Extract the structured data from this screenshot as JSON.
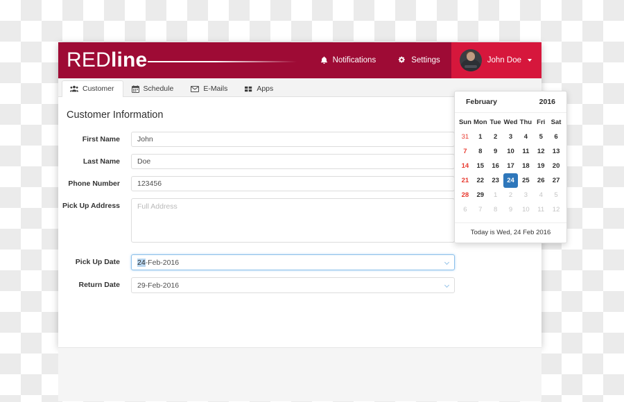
{
  "brand": {
    "red_part": "RED",
    "line_part": "line",
    "accent_color": "#9e0b35",
    "accent_color_light": "#d6173c"
  },
  "header": {
    "nav": [
      {
        "label": "Notifications",
        "icon": "bell-icon"
      },
      {
        "label": "Settings",
        "icon": "gear-icon"
      }
    ],
    "user": {
      "name": "John Doe",
      "avatar_icon": "avatar",
      "caret_icon": "caret-down-icon"
    }
  },
  "tabs": [
    {
      "label": "Customer",
      "icon": "users-icon",
      "active": true
    },
    {
      "label": "Schedule",
      "icon": "calendar-icon",
      "active": false
    },
    {
      "label": "E-Mails",
      "icon": "envelope-icon",
      "active": false
    },
    {
      "label": "Apps",
      "icon": "grid-icon",
      "active": false
    }
  ],
  "main": {
    "title": "Customer Information",
    "fields": {
      "first_name": {
        "label": "First Name",
        "value": "John",
        "placeholder": ""
      },
      "last_name": {
        "label": "Last Name",
        "value": "Doe",
        "placeholder": ""
      },
      "phone_number": {
        "label": "Phone Number",
        "value": "123456",
        "placeholder": ""
      },
      "pick_up_address": {
        "label": "Pick Up Address",
        "value": "",
        "placeholder": "Full Address"
      },
      "pick_up_date": {
        "label": "Pick Up Date",
        "value": "24-Feb-2016",
        "selected_text": "24",
        "rest_text": "-Feb-2016",
        "focused": true
      },
      "return_date": {
        "label": "Return Date",
        "value": "29-Feb-2016",
        "focused": false
      }
    }
  },
  "datepicker": {
    "month": "February",
    "year": "2016",
    "weekdays": [
      "Sun",
      "Mon",
      "Tue",
      "Wed",
      "Thu",
      "Fri",
      "Sat"
    ],
    "selected_day": 24,
    "footer": "Today is Wed, 24 Feb 2016",
    "weeks": [
      [
        {
          "d": "31",
          "muted": true,
          "sunday": true,
          "selected": false
        },
        {
          "d": "1",
          "muted": false,
          "sunday": false,
          "selected": false
        },
        {
          "d": "2",
          "muted": false,
          "sunday": false,
          "selected": false
        },
        {
          "d": "3",
          "muted": false,
          "sunday": false,
          "selected": false
        },
        {
          "d": "4",
          "muted": false,
          "sunday": false,
          "selected": false
        },
        {
          "d": "5",
          "muted": false,
          "sunday": false,
          "selected": false
        },
        {
          "d": "6",
          "muted": false,
          "sunday": false,
          "selected": false
        }
      ],
      [
        {
          "d": "7",
          "muted": false,
          "sunday": true,
          "selected": false
        },
        {
          "d": "8",
          "muted": false,
          "sunday": false,
          "selected": false
        },
        {
          "d": "9",
          "muted": false,
          "sunday": false,
          "selected": false
        },
        {
          "d": "10",
          "muted": false,
          "sunday": false,
          "selected": false
        },
        {
          "d": "11",
          "muted": false,
          "sunday": false,
          "selected": false
        },
        {
          "d": "12",
          "muted": false,
          "sunday": false,
          "selected": false
        },
        {
          "d": "13",
          "muted": false,
          "sunday": false,
          "selected": false
        }
      ],
      [
        {
          "d": "14",
          "muted": false,
          "sunday": true,
          "selected": false
        },
        {
          "d": "15",
          "muted": false,
          "sunday": false,
          "selected": false
        },
        {
          "d": "16",
          "muted": false,
          "sunday": false,
          "selected": false
        },
        {
          "d": "17",
          "muted": false,
          "sunday": false,
          "selected": false
        },
        {
          "d": "18",
          "muted": false,
          "sunday": false,
          "selected": false
        },
        {
          "d": "19",
          "muted": false,
          "sunday": false,
          "selected": false
        },
        {
          "d": "20",
          "muted": false,
          "sunday": false,
          "selected": false
        }
      ],
      [
        {
          "d": "21",
          "muted": false,
          "sunday": true,
          "selected": false
        },
        {
          "d": "22",
          "muted": false,
          "sunday": false,
          "selected": false
        },
        {
          "d": "23",
          "muted": false,
          "sunday": false,
          "selected": false
        },
        {
          "d": "24",
          "muted": false,
          "sunday": false,
          "selected": true
        },
        {
          "d": "25",
          "muted": false,
          "sunday": false,
          "selected": false
        },
        {
          "d": "26",
          "muted": false,
          "sunday": false,
          "selected": false
        },
        {
          "d": "27",
          "muted": false,
          "sunday": false,
          "selected": false
        }
      ],
      [
        {
          "d": "28",
          "muted": false,
          "sunday": true,
          "selected": false
        },
        {
          "d": "29",
          "muted": false,
          "sunday": false,
          "selected": false
        },
        {
          "d": "1",
          "muted": true,
          "sunday": false,
          "selected": false
        },
        {
          "d": "2",
          "muted": true,
          "sunday": false,
          "selected": false
        },
        {
          "d": "3",
          "muted": true,
          "sunday": false,
          "selected": false
        },
        {
          "d": "4",
          "muted": true,
          "sunday": false,
          "selected": false
        },
        {
          "d": "5",
          "muted": true,
          "sunday": false,
          "selected": false
        }
      ],
      [
        {
          "d": "6",
          "muted": true,
          "sunday": false,
          "selected": false
        },
        {
          "d": "7",
          "muted": true,
          "sunday": false,
          "selected": false
        },
        {
          "d": "8",
          "muted": true,
          "sunday": false,
          "selected": false
        },
        {
          "d": "9",
          "muted": true,
          "sunday": false,
          "selected": false
        },
        {
          "d": "10",
          "muted": true,
          "sunday": false,
          "selected": false
        },
        {
          "d": "11",
          "muted": true,
          "sunday": false,
          "selected": false
        },
        {
          "d": "12",
          "muted": true,
          "sunday": false,
          "selected": false
        }
      ]
    ]
  }
}
